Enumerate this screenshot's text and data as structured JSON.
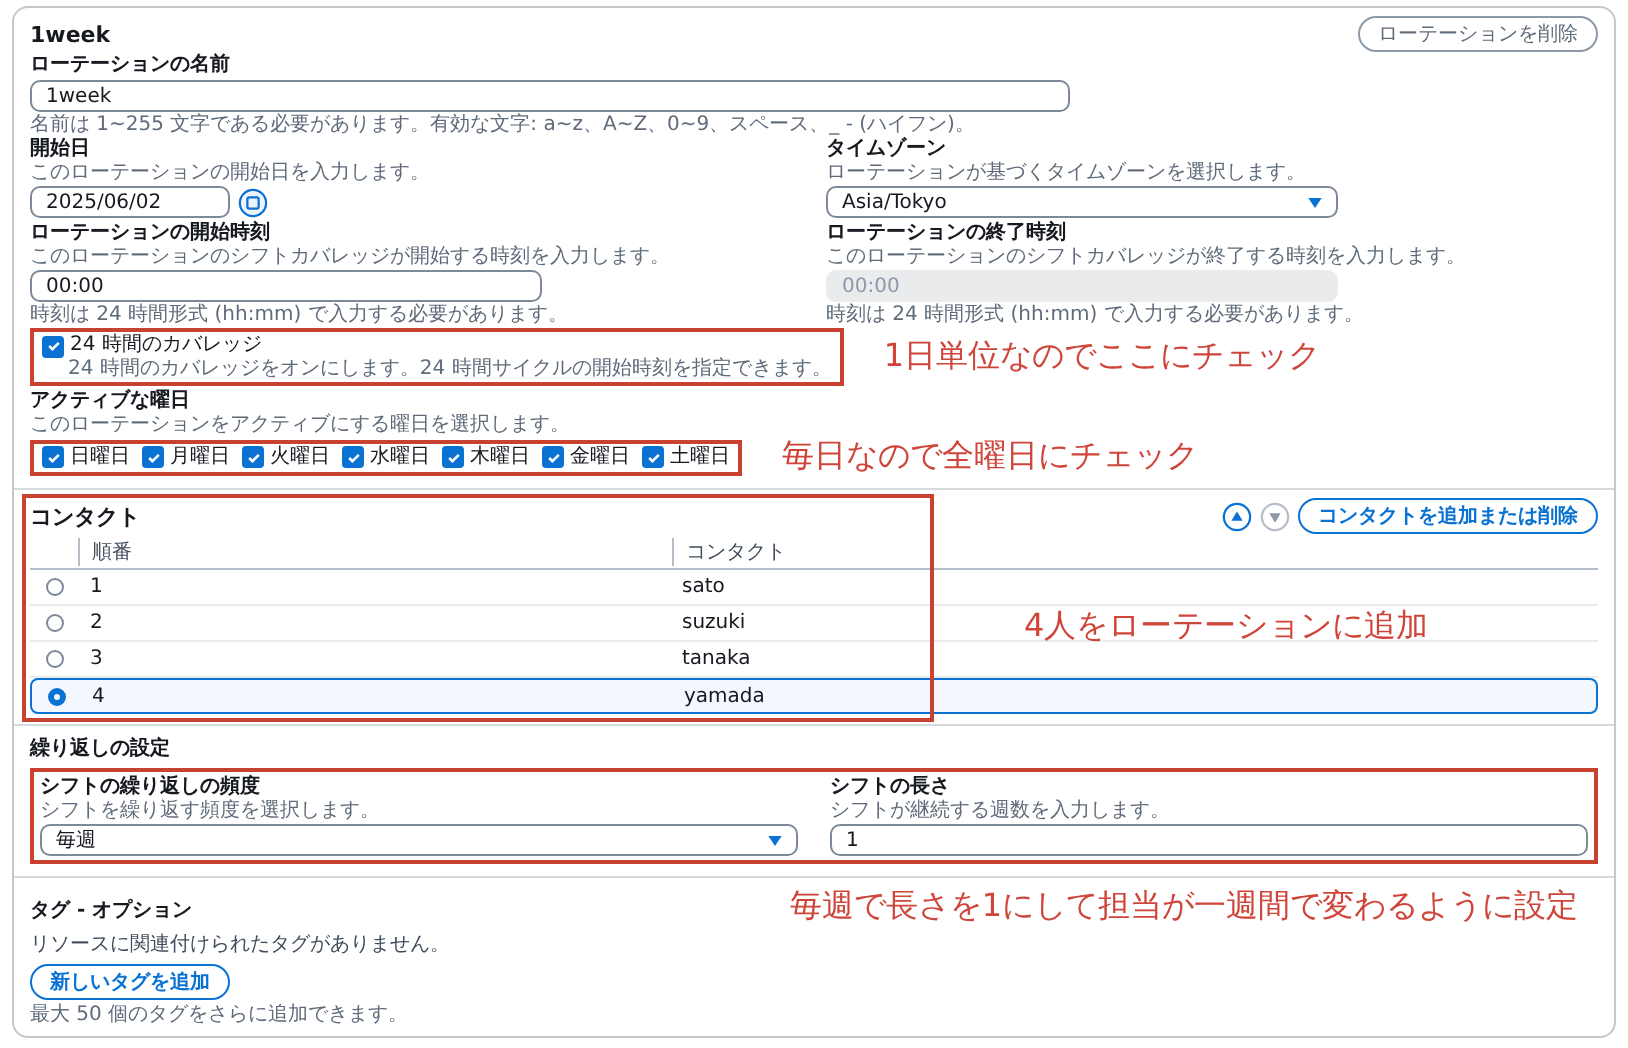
{
  "rotation": {
    "title": "1week",
    "delete_button": "ローテーションを削除",
    "name": {
      "label": "ローテーションの名前",
      "value": "1week",
      "hint": "名前は 1~255 文字である必要があります。有効な文字: a~z、A~Z、0~9、スペース、_ - (ハイフン)。"
    },
    "start_date": {
      "label": "開始日",
      "description": "このローテーションの開始日を入力します。",
      "value": "2025/06/02"
    },
    "time_zone": {
      "label": "タイムゾーン",
      "description": "ローテーションが基づくタイムゾーンを選択します。",
      "value": "Asia/Tokyo"
    },
    "start_time": {
      "label": "ローテーションの開始時刻",
      "description": "このローテーションのシフトカバレッジが開始する時刻を入力します。",
      "value": "00:00",
      "disabled": false,
      "hint": "時刻は 24 時間形式 (hh:mm) で入力する必要があります。"
    },
    "end_time": {
      "label": "ローテーションの終了時刻",
      "description": "このローテーションのシフトカバレッジが終了する時刻を入力します。",
      "value": "00:00",
      "disabled": true,
      "hint": "時刻は 24 時間形式 (hh:mm) で入力する必要があります。"
    },
    "coverage_24h": {
      "label": "24 時間のカバレッジ",
      "description": "24 時間のカバレッジをオンにします。24 時間サイクルの開始時刻を指定できます。",
      "checked": true,
      "annotation": "1日単位なのでここにチェック"
    },
    "active_days": {
      "label": "アクティブな曜日",
      "description": "このローテーションをアクティブにする曜日を選択します。",
      "annotation": "毎日なので全曜日にチェック",
      "days": [
        {
          "label": "日曜日",
          "checked": true
        },
        {
          "label": "月曜日",
          "checked": true
        },
        {
          "label": "火曜日",
          "checked": true
        },
        {
          "label": "水曜日",
          "checked": true
        },
        {
          "label": "木曜日",
          "checked": true
        },
        {
          "label": "金曜日",
          "checked": true
        },
        {
          "label": "土曜日",
          "checked": true
        }
      ]
    }
  },
  "contacts": {
    "title": "コンタクト",
    "annotation": "4人をローテーションに追加",
    "manage_button": "コンタクトを追加または削除",
    "move_buttons": [
      {
        "kind": "up",
        "disabled": false
      },
      {
        "kind": "down",
        "disabled": true
      }
    ],
    "columns": [
      "順番",
      "コンタクト"
    ],
    "rows": [
      {
        "order": "1",
        "contact": "sato",
        "selected": false
      },
      {
        "order": "2",
        "contact": "suzuki",
        "selected": false
      },
      {
        "order": "3",
        "contact": "tanaka",
        "selected": false
      },
      {
        "order": "4",
        "contact": "yamada",
        "selected": true
      }
    ]
  },
  "recurrence": {
    "title": "繰り返しの設定",
    "annotation": "毎週で長さを1にして担当が一週間で変わるように設定",
    "frequency": {
      "label": "シフトの繰り返しの頻度",
      "description": "シフトを繰り返す頻度を選択します。",
      "value": "毎週"
    },
    "length": {
      "label": "シフトの長さ",
      "description": "シフトが継続する週数を入力します。",
      "value": "1"
    }
  },
  "tags": {
    "title": "タグ - オプション",
    "empty_text": "リソースに関連付けられたタグがありません。",
    "add_button": "新しいタグを追加",
    "hint": "最大 50 個のタグをさらに追加できます。"
  }
}
